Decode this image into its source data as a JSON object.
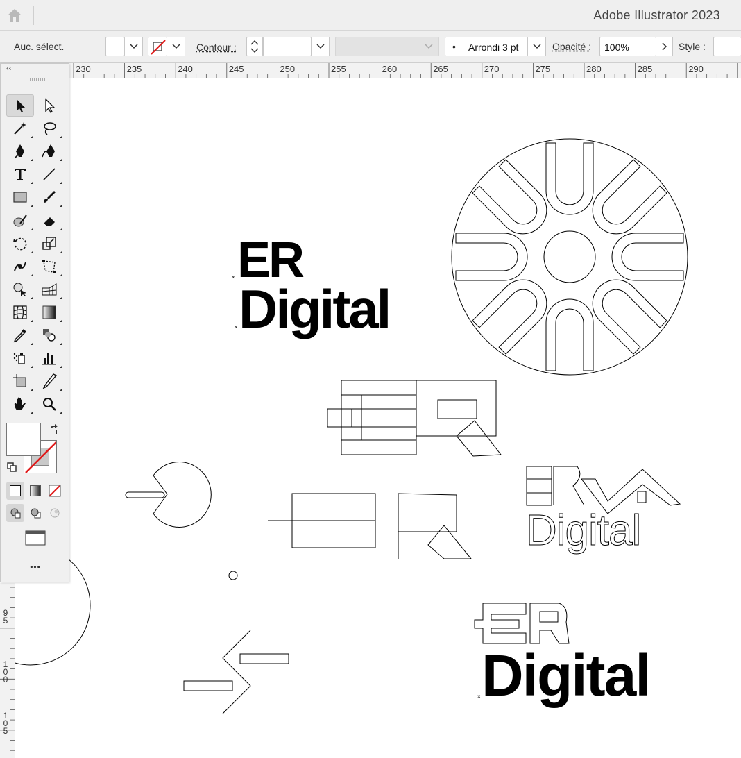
{
  "app": {
    "title": "Adobe Illustrator 2023"
  },
  "control_bar": {
    "selection_label": "Auc. sélect.",
    "stroke_label": "Contour :",
    "brush_value": "Arrondi 3 pt",
    "opacity_label": "Opacité :",
    "opacity_value": "100%",
    "style_label": "Style :"
  },
  "ruler": {
    "top_ticks": [
      "230",
      "235",
      "240",
      "245",
      "250",
      "255",
      "260",
      "265",
      "270",
      "275",
      "280",
      "285",
      "290"
    ],
    "left_ticks": [
      "95",
      "100",
      "105"
    ]
  },
  "toolbar": {
    "collapse_label": "‹‹",
    "more_label": "•••",
    "tools": [
      {
        "name": "selection-tool",
        "icon": "arrow-filled"
      },
      {
        "name": "direct-selection-tool",
        "icon": "arrow-hollow"
      },
      {
        "name": "magic-wand-tool",
        "icon": "magic-wand"
      },
      {
        "name": "lasso-tool",
        "icon": "lasso"
      },
      {
        "name": "pen-tool",
        "icon": "pen"
      },
      {
        "name": "curvature-tool",
        "icon": "curvature-pen"
      },
      {
        "name": "type-tool",
        "icon": "type-T"
      },
      {
        "name": "line-segment-tool",
        "icon": "line"
      },
      {
        "name": "rectangle-tool",
        "icon": "rectangle"
      },
      {
        "name": "paintbrush-tool",
        "icon": "brush"
      },
      {
        "name": "shaper-tool",
        "icon": "shaper"
      },
      {
        "name": "eraser-tool",
        "icon": "eraser"
      },
      {
        "name": "rotate-tool",
        "icon": "rotate"
      },
      {
        "name": "scale-tool",
        "icon": "scale"
      },
      {
        "name": "warp-tool",
        "icon": "warp"
      },
      {
        "name": "free-transform-tool",
        "icon": "free-transform"
      },
      {
        "name": "shape-builder-tool",
        "icon": "shape-builder"
      },
      {
        "name": "perspective-grid-tool",
        "icon": "perspective-grid"
      },
      {
        "name": "mesh-tool",
        "icon": "mesh"
      },
      {
        "name": "gradient-tool",
        "icon": "gradient"
      },
      {
        "name": "eyedropper-tool",
        "icon": "eyedropper"
      },
      {
        "name": "blend-tool",
        "icon": "blend"
      },
      {
        "name": "symbol-sprayer-tool",
        "icon": "symbol-sprayer"
      },
      {
        "name": "column-graph-tool",
        "icon": "column-graph"
      },
      {
        "name": "artboard-tool",
        "icon": "artboard"
      },
      {
        "name": "slice-tool",
        "icon": "slice"
      },
      {
        "name": "hand-tool",
        "icon": "hand"
      },
      {
        "name": "zoom-tool",
        "icon": "magnifier"
      }
    ]
  },
  "artwork": {
    "logo_word_1": "ER",
    "logo_word_2": "Digital"
  },
  "colors": {
    "ui_bg": "#efefef",
    "none_red": "#e01b1b",
    "ink": "#000000"
  }
}
